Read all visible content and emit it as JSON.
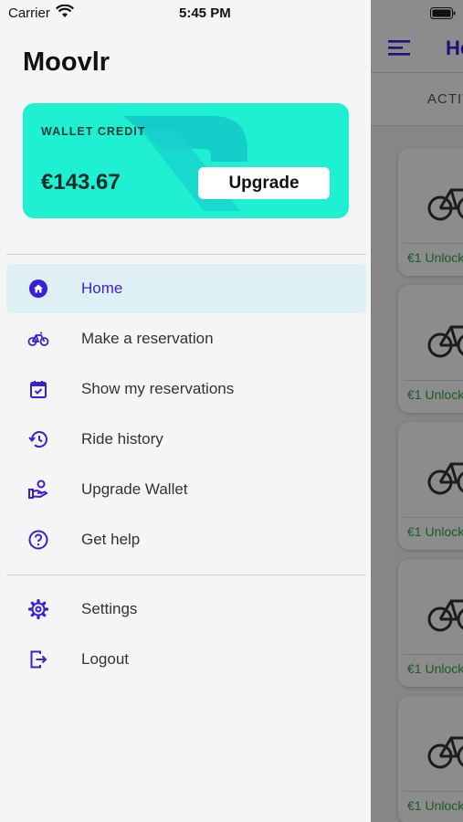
{
  "status_bar": {
    "carrier": "Carrier",
    "time": "5:45 PM"
  },
  "app_name": "Moovlr",
  "wallet": {
    "label": "WALLET CREDIT",
    "amount": "€143.67",
    "upgrade_label": "Upgrade",
    "color": "#1ff0d2"
  },
  "nav": {
    "items": [
      {
        "label": "Home",
        "icon": "home-icon",
        "active": true
      },
      {
        "label": "Make a reservation",
        "icon": "bike-icon"
      },
      {
        "label": "Show my reservations",
        "icon": "calendar-check-icon"
      },
      {
        "label": "Ride history",
        "icon": "history-icon"
      },
      {
        "label": "Upgrade Wallet",
        "icon": "hand-coin-icon"
      },
      {
        "label": "Get help",
        "icon": "help-circle-icon"
      }
    ],
    "secondary": [
      {
        "label": "Settings",
        "icon": "gear-icon"
      },
      {
        "label": "Logout",
        "icon": "logout-icon"
      }
    ]
  },
  "background": {
    "title": "He",
    "tab_label": "ACTIV",
    "bike_cards": [
      {
        "unlock_text": "€1 Unlock"
      },
      {
        "unlock_text": "€1 Unlock"
      },
      {
        "unlock_text": "€1 Unlock"
      },
      {
        "unlock_text": "€1 Unlock"
      },
      {
        "unlock_text": "€1 Unlock"
      }
    ]
  },
  "colors": {
    "accent": "#3a1fd6",
    "active_bg": "#dff0f4",
    "unlock_green": "#2fa84a"
  }
}
